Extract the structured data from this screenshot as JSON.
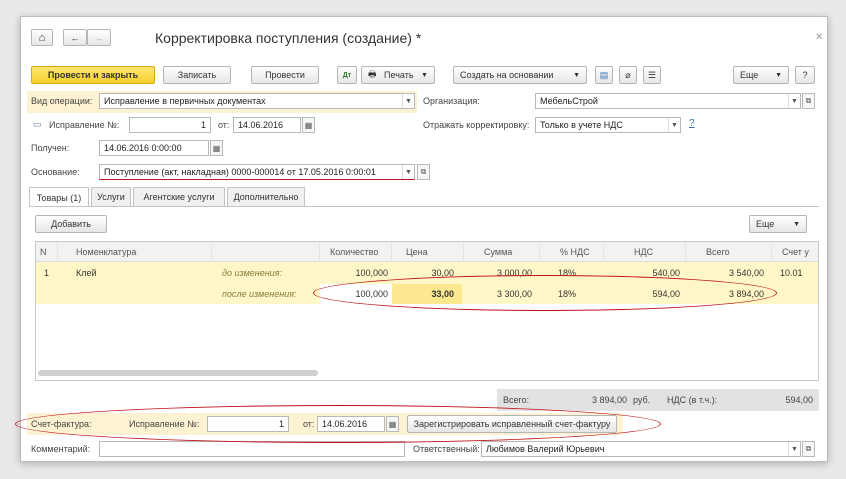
{
  "window": {
    "title": "Корректировка поступления (создание) *"
  },
  "toolbar": {
    "post_close": "Провести и закрыть",
    "save": "Записать",
    "post": "Провести",
    "print": "Печать",
    "create_based": "Создать на основании",
    "more": "Еще",
    "help": "?"
  },
  "form": {
    "operation_label": "Вид операции:",
    "operation_value": "Исправление в первичных документах",
    "org_label": "Организация:",
    "org_value": "МебельСтрой",
    "correction_label": "Исправление №:",
    "correction_value": "1",
    "from_label": "от:",
    "from_value": "14.06.2016",
    "reflect_label": "Отражать корректировку:",
    "reflect_value": "Только в учете НДС",
    "reflect_help": "?",
    "received_label": "Получен:",
    "received_value": "14.06.2016  0:00:00",
    "basis_label": "Основание:",
    "basis_value": "Поступление (акт, накладная) 0000-000014 от 17.05.2016 0:00:01"
  },
  "tabs": [
    "Товары (1)",
    "Услуги",
    "Агентские услуги",
    "Дополнительно"
  ],
  "table_toolbar": {
    "add": "Добавить",
    "more": "Еще"
  },
  "table": {
    "headers": [
      "N",
      "Номенклатура",
      "",
      "Количество",
      "Цена",
      "Сумма",
      "% НДС",
      "НДС",
      "Всего",
      "Счет у"
    ],
    "row_before": [
      "1",
      "Клей",
      "до изменения:",
      "100,000",
      "30,00",
      "3 000,00",
      "18%",
      "540,00",
      "3 540,00",
      "10.01"
    ],
    "row_after": [
      "",
      "",
      "после изменения:",
      "100,000",
      "33,00",
      "3 300,00",
      "18%",
      "594,00",
      "3 894,00",
      ""
    ]
  },
  "totals": {
    "total_label": "Всего:",
    "total_value": "3 894,00",
    "currency": "руб.",
    "vat_label": "НДС (в т.ч.):",
    "vat_value": "594,00"
  },
  "invoice": {
    "label": "Счет-фактура:",
    "correction_label": "Исправление №:",
    "correction_value": "1",
    "from_label": "от:",
    "from_value": "14.06.2016",
    "register_button": "Зарегистрировать исправленный счет-фактуру"
  },
  "footer": {
    "comment_label": "Комментарий:",
    "comment_value": "",
    "responsible_label": "Ответственный:",
    "responsible_value": "Любимов Валерий Юрьевич"
  },
  "colors": {
    "accent_yellow": "#f5cf2e",
    "highlight_row": "#fff7c8",
    "annotation_red": "#c0141c"
  }
}
